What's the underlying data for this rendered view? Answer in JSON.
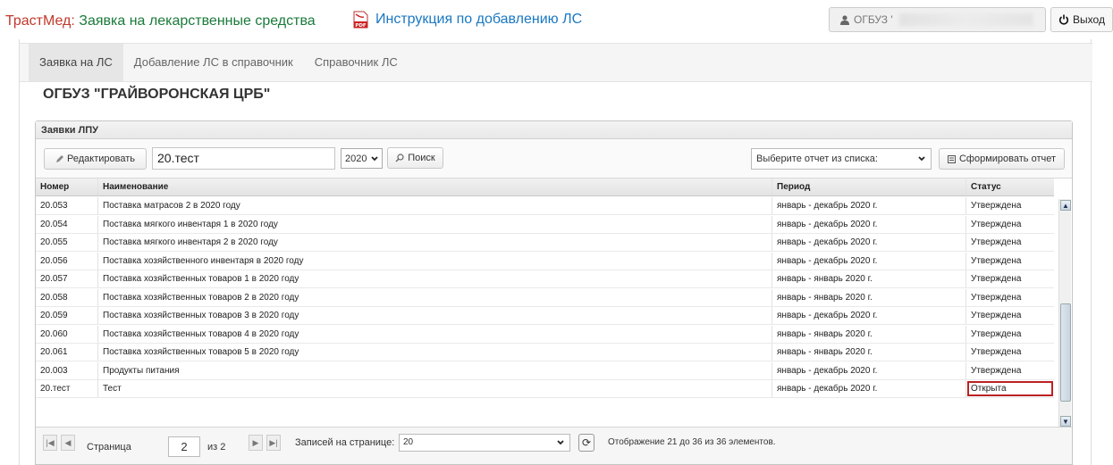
{
  "header": {
    "brand_part1": "ТрастМед:",
    "brand_part2": "Заявка на лекарственные средства",
    "pdf_badge": "PDF",
    "instruction_link": "Инструкция по добавлению ЛС",
    "user_label": "ОГБУЗ '",
    "logout_label": "Выход"
  },
  "tabs": [
    {
      "label": "Заявка на ЛС",
      "active": true
    },
    {
      "label": "Добавление ЛС в справочник"
    },
    {
      "label": "Справочник ЛС"
    }
  ],
  "organization": "ОГБУЗ \"ГРАЙВОРОНСКАЯ ЦРБ\"",
  "panel": {
    "title": "Заявки ЛПУ",
    "edit_button": "Редактировать",
    "search_value": "20.тест",
    "year_value": "2020",
    "search_button": "Поиск",
    "report_placeholder": "Выберите отчет из списка:",
    "report_button": "Сформировать отчет"
  },
  "table": {
    "columns": [
      "Номер",
      "Наименование",
      "Период",
      "Статус"
    ],
    "rows": [
      {
        "num": "20.053",
        "name": "Поставка матрасов 2 в 2020 году",
        "period": "январь - декабрь 2020 г.",
        "status": "Утверждена"
      },
      {
        "num": "20.054",
        "name": "Поставка мягкого инвентаря 1 в 2020 году",
        "period": "январь - декабрь 2020 г.",
        "status": "Утверждена"
      },
      {
        "num": "20.055",
        "name": "Поставка мягкого инвентаря 2 в 2020 году",
        "period": "январь - декабрь 2020 г.",
        "status": "Утверждена"
      },
      {
        "num": "20.056",
        "name": "Поставка хозяйственного инвентаря в 2020 году",
        "period": "январь - декабрь 2020 г.",
        "status": "Утверждена"
      },
      {
        "num": "20.057",
        "name": "Поставка хозяйственных товаров 1 в 2020 году",
        "period": "январь - январь 2020 г.",
        "status": "Утверждена"
      },
      {
        "num": "20.058",
        "name": "Поставка хозяйственных товаров 2 в 2020 году",
        "period": "январь - январь 2020 г.",
        "status": "Утверждена"
      },
      {
        "num": "20.059",
        "name": "Поставка хозяйственных товаров 3 в 2020 году",
        "period": "январь - декабрь 2020 г.",
        "status": "Утверждена"
      },
      {
        "num": "20.060",
        "name": "Поставка хозяйственных товаров 4 в 2020 году",
        "period": "январь - январь 2020 г.",
        "status": "Утверждена"
      },
      {
        "num": "20.061",
        "name": "Поставка хозяйственных товаров 5 в 2020 году",
        "period": "январь - январь 2020 г.",
        "status": "Утверждена"
      },
      {
        "num": "20.003",
        "name": "Продукты питания",
        "period": "январь - декабрь 2020 г.",
        "status": "Утверждена"
      },
      {
        "num": "20.тест",
        "name": "Тест",
        "period": "январь - декабрь 2020 г.",
        "status": "Открыта",
        "highlight": true
      }
    ]
  },
  "pager": {
    "page_label": "Страница",
    "page_value": "2",
    "of_label": "из 2",
    "per_page_label": "Записей на странице:",
    "per_page_value": "20",
    "display_text": "Отображение 21 до 36 из 36 элементов."
  },
  "colors": {
    "brand_red": "#c0392b",
    "brand_green": "#1a7a3a",
    "link_blue": "#1a78c2",
    "highlight_border": "#b22222"
  }
}
